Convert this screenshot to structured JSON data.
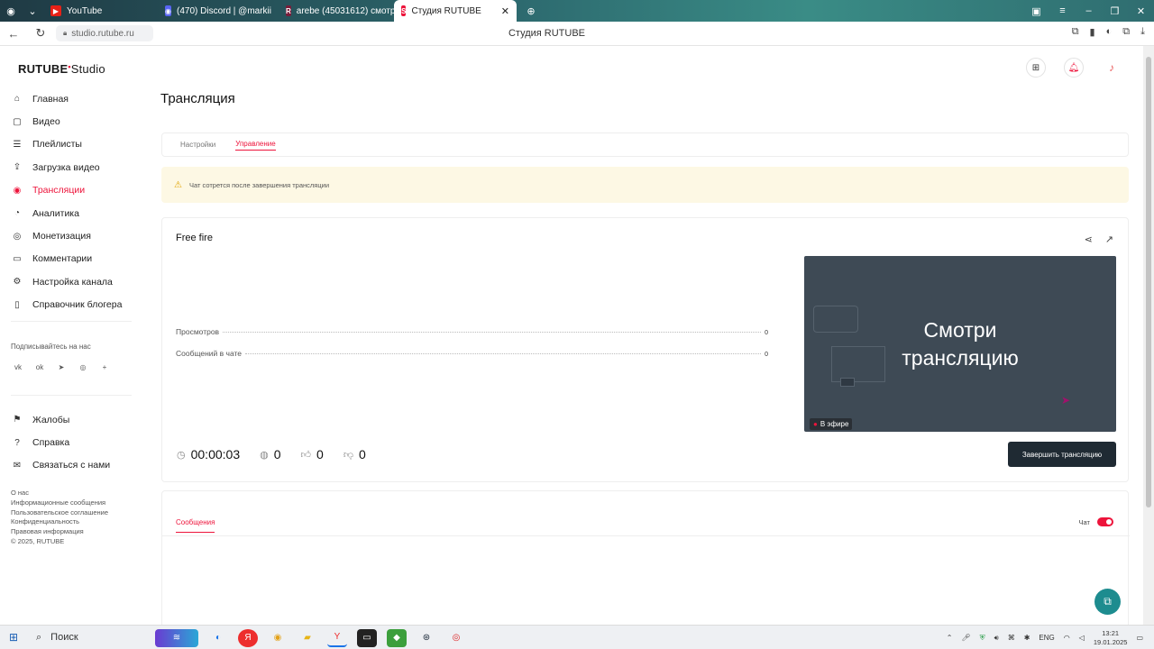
{
  "browser": {
    "tabs": [
      {
        "label": "YouTube",
        "fav_color": "#e62117",
        "fav": "▶",
        "active": false
      },
      {
        "label": "(470) Discord | @markii",
        "fav_color": "#5865f2",
        "fav": "◉",
        "active": false
      },
      {
        "label": "arebe (45031612)   смотр",
        "fav_color": "#e0245e",
        "fav": "R",
        "active": false
      },
      {
        "label": "Студия RUTUBE",
        "fav_color": "#ed143b",
        "fav": "S",
        "active": true
      }
    ],
    "url": "studio.rutube.ru",
    "page_title": "Студия RUTUBE"
  },
  "logo": {
    "main": "RUTUBE",
    "sub": "Studio"
  },
  "sidebar": {
    "items": [
      {
        "label": "Главная",
        "icon": "home-icon",
        "glyph": "⌂"
      },
      {
        "label": "Видео",
        "icon": "video-icon",
        "glyph": "▢"
      },
      {
        "label": "Плейлисты",
        "icon": "playlist-icon",
        "glyph": "☰"
      },
      {
        "label": "Загрузка видео",
        "icon": "upload-icon",
        "glyph": "⇪"
      },
      {
        "label": "Трансляции",
        "icon": "broadcast-icon",
        "glyph": "◉"
      },
      {
        "label": "Аналитика",
        "icon": "analytics-icon",
        "glyph": "◔"
      },
      {
        "label": "Монетизация",
        "icon": "money-icon",
        "glyph": "◎"
      },
      {
        "label": "Комментарии",
        "icon": "comments-icon",
        "glyph": "▭"
      },
      {
        "label": "Настройка канала",
        "icon": "settings-icon",
        "glyph": "⚙"
      },
      {
        "label": "Справочник блогера",
        "icon": "book-icon",
        "glyph": "▯"
      }
    ],
    "active_index": 4,
    "follow_label": "Подписывайтесь на нас",
    "socials": [
      {
        "icon": "vk-icon",
        "glyph": "vk"
      },
      {
        "icon": "ok-icon",
        "glyph": "ok"
      },
      {
        "icon": "telegram-icon",
        "glyph": "➤"
      },
      {
        "icon": "dzen-icon",
        "glyph": "◎"
      },
      {
        "icon": "more-icon",
        "glyph": "+"
      }
    ],
    "items2": [
      {
        "label": "Жалобы",
        "icon": "flag-icon",
        "glyph": "⚑"
      },
      {
        "label": "Справка",
        "icon": "help-icon",
        "glyph": "?"
      },
      {
        "label": "Связаться с нами",
        "icon": "mail-icon",
        "glyph": "✉"
      }
    ],
    "footer_links": [
      "О нас",
      "Информационные сообщения",
      "Пользовательское соглашение",
      "Конфиденциальность",
      "Правовая информация"
    ],
    "copyright": "© 2025, RUTUBE"
  },
  "header": {
    "icons": [
      "add-video-icon",
      "notifications-icon",
      "avatar"
    ]
  },
  "page": {
    "title": "Трансляция",
    "tabs": [
      {
        "label": "Настройки",
        "active": false
      },
      {
        "label": "Управление",
        "active": true
      }
    ],
    "warning": "Чат сотрется после завершения трансляции"
  },
  "stream": {
    "title": "Free fire",
    "stats": [
      {
        "label": "Просмотров",
        "value": "0"
      },
      {
        "label": "Сообщений в чате",
        "value": "0"
      }
    ],
    "duration": "00:00:03",
    "viewers": "0",
    "likes": "0",
    "dislikes": "0",
    "preview_line1": "Смотри",
    "preview_line2": "трансляцию",
    "live_badge": "В эфире",
    "end_button": "Завершить трансляцию"
  },
  "chat": {
    "tab": "Сообщения",
    "toggle_label": "Чат",
    "enabled": true
  },
  "taskbar": {
    "search": "Поиск",
    "lang": "ENG",
    "time": "13:21",
    "date": "19.01.2025"
  }
}
